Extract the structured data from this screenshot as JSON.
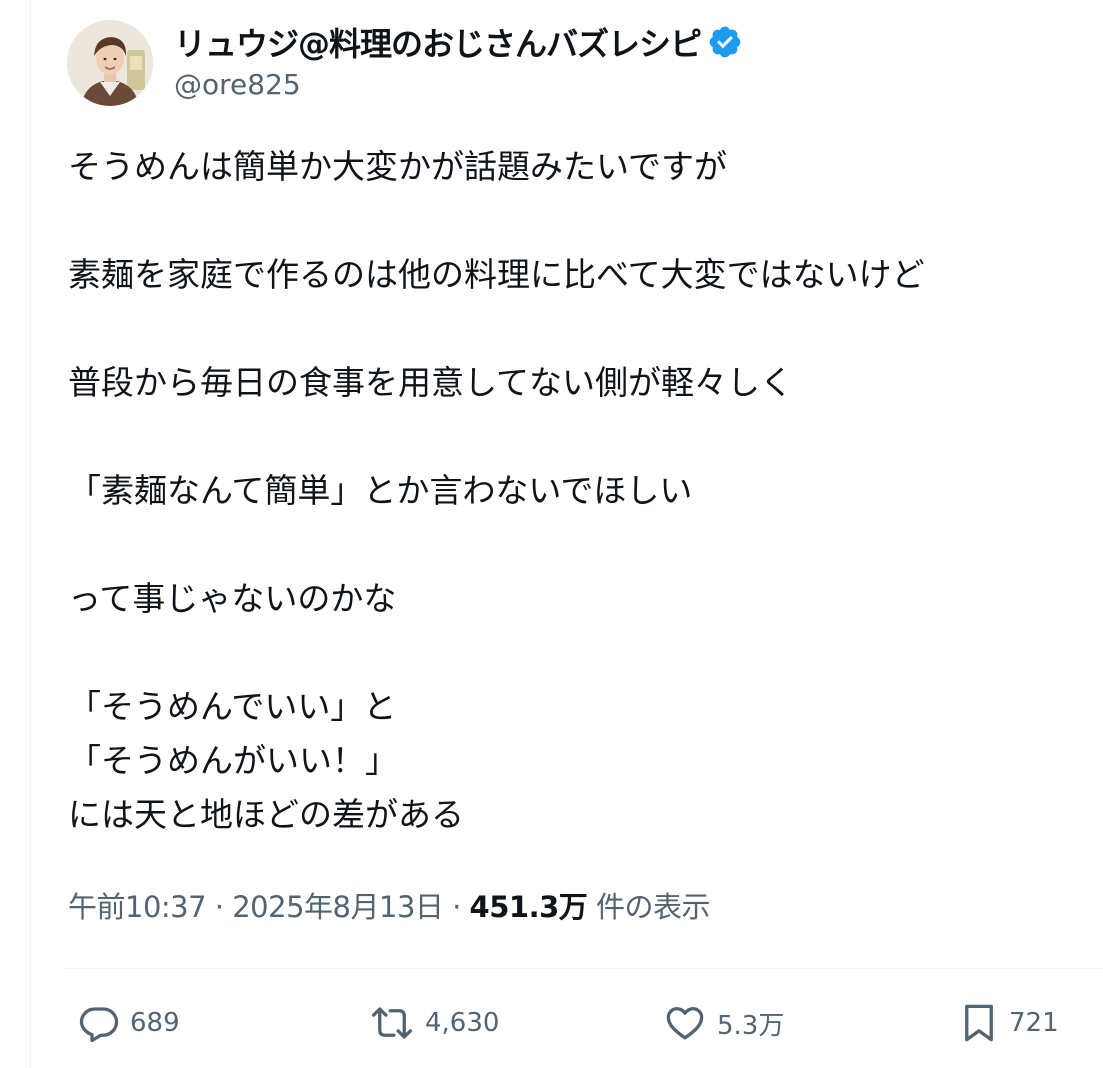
{
  "author": {
    "name": "リュウジ@料理のおじさんバズレシピ",
    "handle": "@ore825",
    "verified": true
  },
  "body_lines": [
    "そうめんは簡単か大変かが話題みたいですが",
    "",
    "素麺を家庭で作るのは他の料理に比べて大変ではないけど",
    "",
    "普段から毎日の食事を用意してない側が軽々しく",
    "",
    "「素麺なんて簡単」とか言わないでほしい",
    "",
    "って事じゃないのかな",
    "",
    "「そうめんでいい」と",
    "「そうめんがいい！」",
    "には天と地ほどの差がある"
  ],
  "meta": {
    "time": "午前10:37",
    "separator": "·",
    "date": "2025年8月13日",
    "views_count": "451.3万",
    "views_label": "件の表示"
  },
  "actions": {
    "reply": {
      "icon": "reply-icon",
      "count": "689"
    },
    "repost": {
      "icon": "repost-icon",
      "count": "4,630"
    },
    "like": {
      "icon": "heart-icon",
      "count": "5.3万"
    },
    "bookmark": {
      "icon": "bookmark-icon",
      "count": "721"
    }
  },
  "colors": {
    "text": "#0f1419",
    "secondary": "#536471",
    "verified": "#1d9bf0",
    "divider": "#eff3f4"
  }
}
